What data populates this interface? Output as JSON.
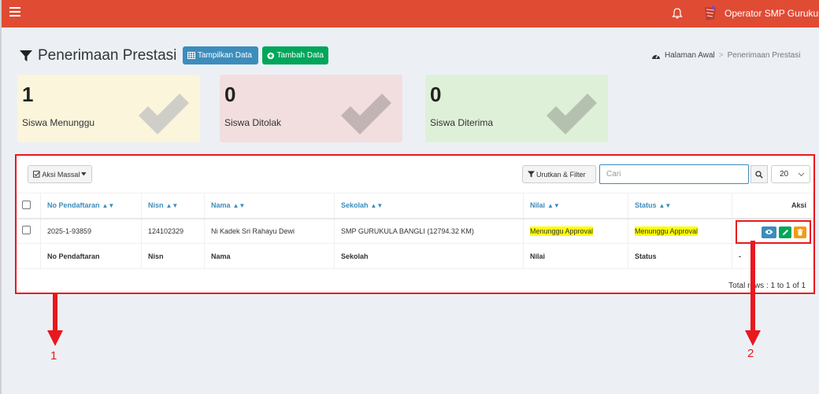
{
  "topbar": {
    "menu_icon": "hamburger-icon",
    "bell_icon": "bell-icon",
    "user_name": "Operator SMP Gurukula",
    "brand_color": "#e04b34"
  },
  "header": {
    "title": "Penerimaan Prestasi",
    "btn_show": "Tampilkan Data",
    "btn_add": "Tambah Data",
    "breadcrumb_home": "Halaman Awal",
    "breadcrumb_current": "Penerimaan Prestasi"
  },
  "stats": [
    {
      "value": "1",
      "label": "Siswa Menunggu",
      "color": "#fbf5dc"
    },
    {
      "value": "0",
      "label": "Siswa Ditolak",
      "color": "#f2dede"
    },
    {
      "value": "0",
      "label": "Siswa Diterima",
      "color": "#dff0d8"
    }
  ],
  "toolbar": {
    "bulk_label": "Aksi Massal",
    "sort_filter_label": "Urutkan & Filter",
    "search_placeholder": "Cari",
    "page_size": "20"
  },
  "table": {
    "headers": {
      "no": "No Pendaftaran",
      "nisn": "Nisn",
      "nama": "Nama",
      "sekolah": "Sekolah",
      "nilai": "Nilai",
      "status": "Status",
      "aksi": "Aksi"
    },
    "rows": [
      {
        "no": "2025-1-93859",
        "nisn": "124102329",
        "nama": "Ni Kadek Sri Rahayu Dewi",
        "sekolah": "SMP GURUKULA BANGLI (12794.32 KM)",
        "nilai": "Menunggu Approval",
        "status": "Menunggu Approval"
      }
    ],
    "footer": {
      "no": "No Pendaftaran",
      "nisn": "Nisn",
      "nama": "Nama",
      "sekolah": "Sekolah",
      "nilai": "Nilai",
      "status": "Status",
      "aksi": "-"
    },
    "total": "Total rows : 1 to 1 of 1"
  },
  "annotations": {
    "label_1": "1",
    "label_2": "2",
    "color": "#e8181e"
  }
}
